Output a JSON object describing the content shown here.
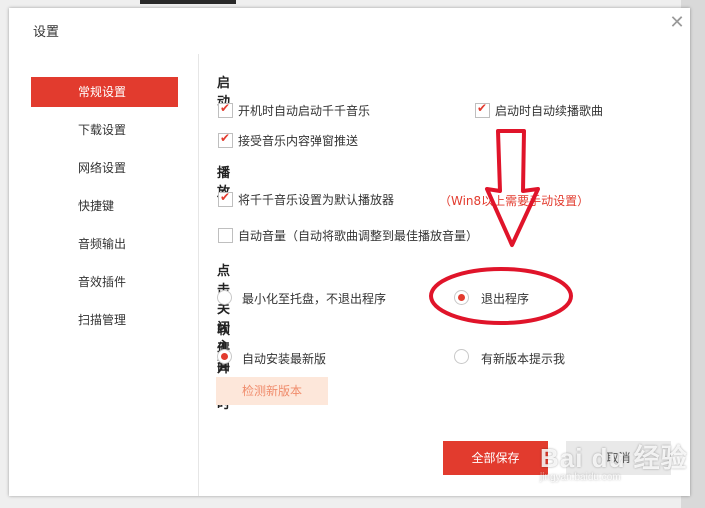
{
  "dialog": {
    "title": "设置",
    "close_glyph": "✕"
  },
  "sidebar": {
    "items": [
      {
        "label": "常规设置",
        "active": true
      },
      {
        "label": "下载设置"
      },
      {
        "label": "网络设置"
      },
      {
        "label": "快捷键"
      },
      {
        "label": "音频输出"
      },
      {
        "label": "音效插件"
      },
      {
        "label": "扫描管理"
      }
    ]
  },
  "startup": {
    "title": "启动",
    "autostart": {
      "label": "开机时自动启动千千音乐",
      "checked": true
    },
    "resume_play": {
      "label": "启动时自动续播歌曲",
      "checked": true
    },
    "accept_push": {
      "label": "接受音乐内容弹窗推送",
      "checked": true
    }
  },
  "playback": {
    "title": "播放",
    "default_player": {
      "label": "将千千音乐设置为默认播放器",
      "checked": true
    },
    "win8_note": "（Win8以上需要手动设置）",
    "auto_volume": {
      "label": "自动音量（自动将歌曲调整到最佳播放音量）",
      "checked": false
    }
  },
  "close_panel": {
    "title": "点击关闭主面板时",
    "minimize": {
      "label": "最小化至托盘，不退出程序",
      "selected": false
    },
    "exit": {
      "label": "退出程序",
      "selected": true
    }
  },
  "upgrade": {
    "title": "软件升级",
    "auto_install": {
      "label": "自动安装最新版",
      "selected": true
    },
    "notify": {
      "label": "有新版本提示我",
      "selected": false
    },
    "check_button": "检测新版本"
  },
  "footer": {
    "save_all": "全部保存",
    "cancel": "取消"
  },
  "watermark": {
    "logo": "Bai du 经验",
    "sub": "jingyan.baidu.com"
  },
  "colors": {
    "accent": "#e23b2e",
    "annotation": "#e0142a"
  }
}
